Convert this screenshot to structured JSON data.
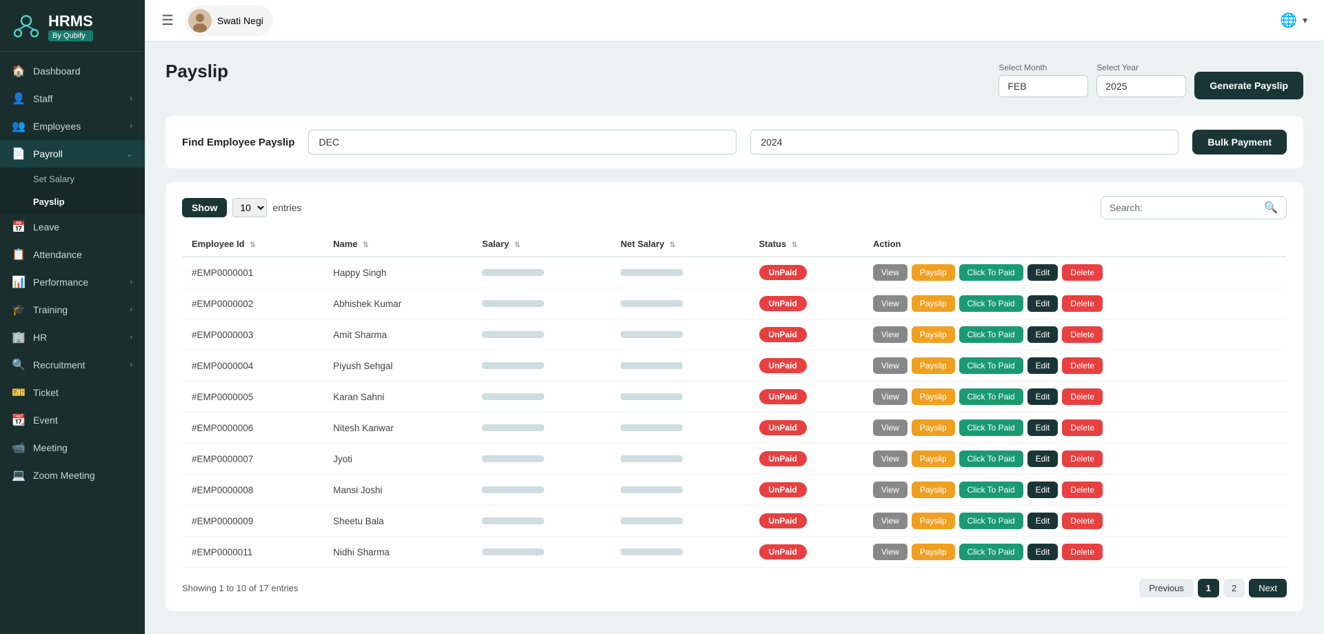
{
  "sidebar": {
    "logo": {
      "hrms": "HRMS",
      "by": "By Qubify"
    },
    "items": [
      {
        "id": "dashboard",
        "label": "Dashboard",
        "icon": "🏠",
        "hasArrow": false
      },
      {
        "id": "staff",
        "label": "Staff",
        "icon": "👤",
        "hasArrow": true
      },
      {
        "id": "employees",
        "label": "Employees",
        "icon": "👥",
        "hasArrow": true
      },
      {
        "id": "payroll",
        "label": "Payroll",
        "icon": "📄",
        "hasArrow": true,
        "active": true,
        "expanded": true
      },
      {
        "id": "leave",
        "label": "Leave",
        "icon": "📅",
        "hasArrow": false
      },
      {
        "id": "attendance",
        "label": "Attendance",
        "icon": "📋",
        "hasArrow": false
      },
      {
        "id": "performance",
        "label": "Performance",
        "icon": "📊",
        "hasArrow": true
      },
      {
        "id": "training",
        "label": "Training",
        "icon": "🎓",
        "hasArrow": true
      },
      {
        "id": "hr",
        "label": "HR",
        "icon": "🏢",
        "hasArrow": true
      },
      {
        "id": "recruitment",
        "label": "Recruitment",
        "icon": "🔍",
        "hasArrow": true
      },
      {
        "id": "ticket",
        "label": "Ticket",
        "icon": "🎫",
        "hasArrow": false
      },
      {
        "id": "event",
        "label": "Event",
        "icon": "📆",
        "hasArrow": false
      },
      {
        "id": "meeting",
        "label": "Meeting",
        "icon": "📹",
        "hasArrow": false
      },
      {
        "id": "zoom-meeting",
        "label": "Zoom Meeting",
        "icon": "💻",
        "hasArrow": false
      }
    ],
    "subItems": [
      {
        "id": "set-salary",
        "label": "Set Salary"
      },
      {
        "id": "payslip",
        "label": "Payslip",
        "active": true
      }
    ]
  },
  "topbar": {
    "user": {
      "name": "Swati Negi"
    },
    "hamburger_icon": "☰",
    "globe_icon": "🌐",
    "dropdown_icon": "▾"
  },
  "page": {
    "title": "Payslip",
    "select_month_label": "Select Month",
    "select_year_label": "Select Year",
    "month_value": "FEB",
    "year_value": "2025",
    "generate_btn": "Generate Payslip",
    "find_label": "Find Employee Payslip",
    "find_month": "DEC",
    "find_year": "2024",
    "bulk_btn": "Bulk Payment",
    "show_label": "Show",
    "entries_label": "entries",
    "entries_value": "10",
    "search_label": "Search:",
    "pagination_info": "Showing 1 to 10 of 17 entries",
    "prev_btn": "Previous",
    "next_btn": "Next",
    "page_numbers": [
      "1",
      "2"
    ]
  },
  "table": {
    "columns": [
      {
        "id": "emp_id",
        "label": "Employee Id"
      },
      {
        "id": "name",
        "label": "Name"
      },
      {
        "id": "salary",
        "label": "Salary"
      },
      {
        "id": "net_salary",
        "label": "Net Salary"
      },
      {
        "id": "status",
        "label": "Status"
      },
      {
        "id": "action",
        "label": "Action"
      }
    ],
    "rows": [
      {
        "emp_id": "#EMP0000001",
        "name": "Happy Singh",
        "status": "UnPaid",
        "btn_click": "Click To Paid"
      },
      {
        "emp_id": "#EMP0000002",
        "name": "Abhishek Kumar",
        "status": "UnPaid",
        "btn_click": "Click To Paid"
      },
      {
        "emp_id": "#EMP0000003",
        "name": "Amit Sharma",
        "status": "UnPaid",
        "btn_click": "Click To Paid"
      },
      {
        "emp_id": "#EMP0000004",
        "name": "Piyush Sehgal",
        "status": "UnPaid",
        "btn_click": "Click To Paid"
      },
      {
        "emp_id": "#EMP0000005",
        "name": "Karan Sahni",
        "status": "UnPaid",
        "btn_click": "Click To Paid"
      },
      {
        "emp_id": "#EMP0000006",
        "name": "Nitesh Kanwar",
        "status": "UnPaid",
        "btn_click": "Click To Paid"
      },
      {
        "emp_id": "#EMP0000007",
        "name": "Jyoti",
        "status": "UnPaid",
        "btn_click": "Click To Paid"
      },
      {
        "emp_id": "#EMP0000008",
        "name": "Mansi Joshi",
        "status": "UnPaid",
        "btn_click": "Click To Paid"
      },
      {
        "emp_id": "#EMP0000009",
        "name": "Sheetu Bala",
        "status": "UnPaid",
        "btn_click": "Click To Paid"
      },
      {
        "emp_id": "#EMP0000011",
        "name": "Nidhi Sharma",
        "status": "UnPaid",
        "btn_click": "Click To Paid"
      }
    ],
    "action_labels": {
      "view": "View",
      "payslip": "Payslip",
      "edit": "Edit",
      "delete": "Delete"
    }
  }
}
